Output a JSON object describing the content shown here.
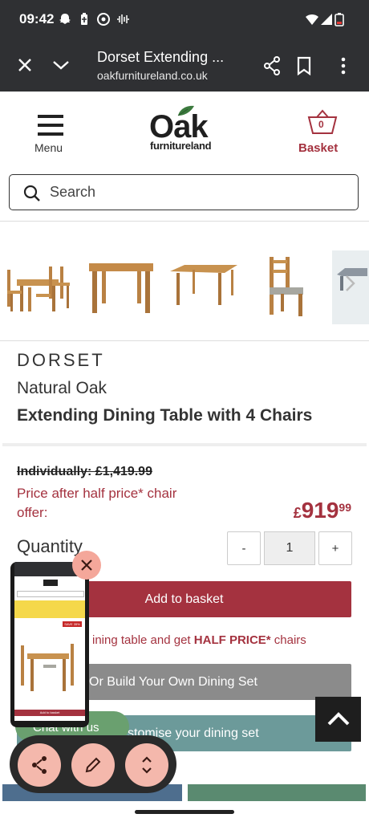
{
  "status_bar": {
    "time": "09:42"
  },
  "browser": {
    "page_title": "Dorset Extending ...",
    "url": "oakfurnitureland.co.uk"
  },
  "site": {
    "menu_label": "Menu",
    "logo_main": "Oak",
    "logo_sub": "furnitureland",
    "basket_label": "Basket",
    "basket_count": "0",
    "search_placeholder": "Search"
  },
  "product": {
    "brand": "DORSET",
    "subtitle": "Natural Oak",
    "title": "Extending Dining Table with 4 Chairs",
    "was_price": "Individually: £1,419.99",
    "offer_text": "Price after half price* chair offer:",
    "price_currency": "£",
    "price_main": "919",
    "price_pence": "99",
    "quantity_label": "Quantity",
    "qty_minus": "-",
    "qty_value": "1",
    "qty_plus": "+",
    "add_to_basket": "Add to basket",
    "promo_text_start": "ining table and get ",
    "promo_bold": "HALF PRICE*",
    "promo_end": " chairs",
    "build_button": "Or Build Your Own Dining Set",
    "customise_button": "stomise your dining set",
    "chat_label": "Chat with us"
  },
  "preview": {
    "badge": "SAVE 35%",
    "add_button": "Add to basket"
  },
  "colors": {
    "brand_red": "#a4323f",
    "dark_bar": "#2f3033",
    "tool_accent": "#f4b8ac"
  }
}
